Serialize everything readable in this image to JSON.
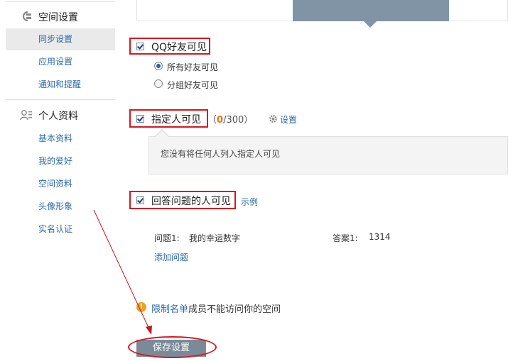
{
  "sidebar": {
    "space_settings": {
      "title": "空间设置",
      "items": [
        {
          "label": "同步设置"
        },
        {
          "label": "应用设置"
        },
        {
          "label": "通知和提醒"
        }
      ]
    },
    "profile": {
      "title": "个人资料",
      "items": [
        {
          "label": "基本资料"
        },
        {
          "label": "我的爱好"
        },
        {
          "label": "空间资料"
        },
        {
          "label": "头像形象"
        },
        {
          "label": "实名认证"
        }
      ]
    }
  },
  "main": {
    "qq_friends": {
      "label": "QQ好友可见",
      "options": [
        {
          "label": "所有好友可见",
          "selected": true
        },
        {
          "label": "分组好友可见",
          "selected": false
        }
      ]
    },
    "specified": {
      "label": "指定人可见",
      "count_open": "（",
      "count": "0",
      "count_total": "/300）",
      "settings_link": "设置",
      "notice": "您没有将任何人列入指定人可见"
    },
    "question": {
      "label": "回答问题的人可见",
      "example_link": "示例",
      "q_label": "问题1:",
      "q_value": "我的幸运数字",
      "a_label": "答案1:",
      "a_value": "1314",
      "add_link": "添加问题"
    },
    "restriction": {
      "link": "限制名单",
      "text": "成员不能访问你的空间"
    },
    "save_label": "保存设置"
  },
  "colors": {
    "highlight": "#d9161d",
    "link": "#2b6aa8",
    "tab": "#8094a6",
    "count": "#e8721c"
  }
}
